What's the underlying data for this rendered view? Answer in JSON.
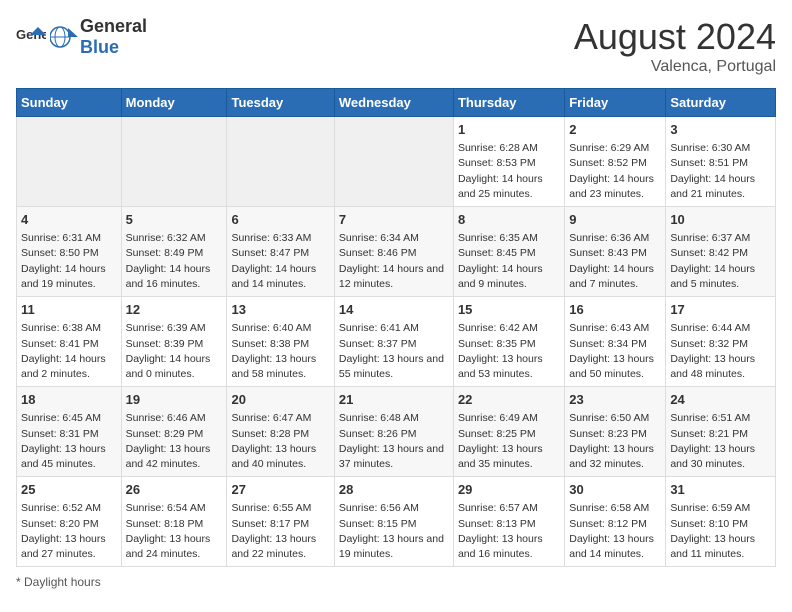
{
  "header": {
    "logo_general": "General",
    "logo_blue": "Blue",
    "title": "August 2024",
    "subtitle": "Valenca, Portugal"
  },
  "calendar": {
    "weekdays": [
      "Sunday",
      "Monday",
      "Tuesday",
      "Wednesday",
      "Thursday",
      "Friday",
      "Saturday"
    ],
    "weeks": [
      [
        {
          "day": "",
          "empty": true
        },
        {
          "day": "",
          "empty": true
        },
        {
          "day": "",
          "empty": true
        },
        {
          "day": "",
          "empty": true
        },
        {
          "day": "1",
          "sunrise": "6:28 AM",
          "sunset": "8:53 PM",
          "daylight": "14 hours and 25 minutes."
        },
        {
          "day": "2",
          "sunrise": "6:29 AM",
          "sunset": "8:52 PM",
          "daylight": "14 hours and 23 minutes."
        },
        {
          "day": "3",
          "sunrise": "6:30 AM",
          "sunset": "8:51 PM",
          "daylight": "14 hours and 21 minutes."
        }
      ],
      [
        {
          "day": "4",
          "sunrise": "6:31 AM",
          "sunset": "8:50 PM",
          "daylight": "14 hours and 19 minutes."
        },
        {
          "day": "5",
          "sunrise": "6:32 AM",
          "sunset": "8:49 PM",
          "daylight": "14 hours and 16 minutes."
        },
        {
          "day": "6",
          "sunrise": "6:33 AM",
          "sunset": "8:47 PM",
          "daylight": "14 hours and 14 minutes."
        },
        {
          "day": "7",
          "sunrise": "6:34 AM",
          "sunset": "8:46 PM",
          "daylight": "14 hours and 12 minutes."
        },
        {
          "day": "8",
          "sunrise": "6:35 AM",
          "sunset": "8:45 PM",
          "daylight": "14 hours and 9 minutes."
        },
        {
          "day": "9",
          "sunrise": "6:36 AM",
          "sunset": "8:43 PM",
          "daylight": "14 hours and 7 minutes."
        },
        {
          "day": "10",
          "sunrise": "6:37 AM",
          "sunset": "8:42 PM",
          "daylight": "14 hours and 5 minutes."
        }
      ],
      [
        {
          "day": "11",
          "sunrise": "6:38 AM",
          "sunset": "8:41 PM",
          "daylight": "14 hours and 2 minutes."
        },
        {
          "day": "12",
          "sunrise": "6:39 AM",
          "sunset": "8:39 PM",
          "daylight": "14 hours and 0 minutes."
        },
        {
          "day": "13",
          "sunrise": "6:40 AM",
          "sunset": "8:38 PM",
          "daylight": "13 hours and 58 minutes."
        },
        {
          "day": "14",
          "sunrise": "6:41 AM",
          "sunset": "8:37 PM",
          "daylight": "13 hours and 55 minutes."
        },
        {
          "day": "15",
          "sunrise": "6:42 AM",
          "sunset": "8:35 PM",
          "daylight": "13 hours and 53 minutes."
        },
        {
          "day": "16",
          "sunrise": "6:43 AM",
          "sunset": "8:34 PM",
          "daylight": "13 hours and 50 minutes."
        },
        {
          "day": "17",
          "sunrise": "6:44 AM",
          "sunset": "8:32 PM",
          "daylight": "13 hours and 48 minutes."
        }
      ],
      [
        {
          "day": "18",
          "sunrise": "6:45 AM",
          "sunset": "8:31 PM",
          "daylight": "13 hours and 45 minutes."
        },
        {
          "day": "19",
          "sunrise": "6:46 AM",
          "sunset": "8:29 PM",
          "daylight": "13 hours and 42 minutes."
        },
        {
          "day": "20",
          "sunrise": "6:47 AM",
          "sunset": "8:28 PM",
          "daylight": "13 hours and 40 minutes."
        },
        {
          "day": "21",
          "sunrise": "6:48 AM",
          "sunset": "8:26 PM",
          "daylight": "13 hours and 37 minutes."
        },
        {
          "day": "22",
          "sunrise": "6:49 AM",
          "sunset": "8:25 PM",
          "daylight": "13 hours and 35 minutes."
        },
        {
          "day": "23",
          "sunrise": "6:50 AM",
          "sunset": "8:23 PM",
          "daylight": "13 hours and 32 minutes."
        },
        {
          "day": "24",
          "sunrise": "6:51 AM",
          "sunset": "8:21 PM",
          "daylight": "13 hours and 30 minutes."
        }
      ],
      [
        {
          "day": "25",
          "sunrise": "6:52 AM",
          "sunset": "8:20 PM",
          "daylight": "13 hours and 27 minutes."
        },
        {
          "day": "26",
          "sunrise": "6:54 AM",
          "sunset": "8:18 PM",
          "daylight": "13 hours and 24 minutes."
        },
        {
          "day": "27",
          "sunrise": "6:55 AM",
          "sunset": "8:17 PM",
          "daylight": "13 hours and 22 minutes."
        },
        {
          "day": "28",
          "sunrise": "6:56 AM",
          "sunset": "8:15 PM",
          "daylight": "13 hours and 19 minutes."
        },
        {
          "day": "29",
          "sunrise": "6:57 AM",
          "sunset": "8:13 PM",
          "daylight": "13 hours and 16 minutes."
        },
        {
          "day": "30",
          "sunrise": "6:58 AM",
          "sunset": "8:12 PM",
          "daylight": "13 hours and 14 minutes."
        },
        {
          "day": "31",
          "sunrise": "6:59 AM",
          "sunset": "8:10 PM",
          "daylight": "13 hours and 11 minutes."
        }
      ]
    ]
  },
  "footer": {
    "daylight_label": "Daylight hours"
  }
}
